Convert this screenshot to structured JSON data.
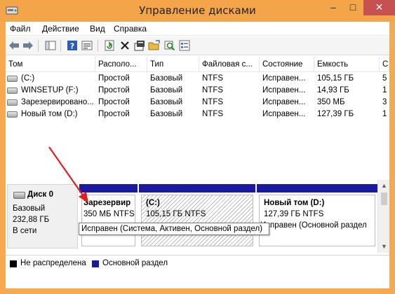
{
  "window": {
    "title": "Управление дисками",
    "controls": {
      "minimize": "–",
      "maximize": "□",
      "close": "✕"
    }
  },
  "menu": [
    "Файл",
    "Действие",
    "Вид",
    "Справка"
  ],
  "toolbar": {
    "icons": [
      "back-arrow-icon",
      "forward-arrow-icon",
      "console-tree-icon",
      "help-icon",
      "properties-icon",
      "refresh-icon",
      "delete-icon",
      "mmc-properties-icon",
      "open-folder-icon",
      "search-disk-icon",
      "view-list-icon"
    ]
  },
  "volumes": {
    "columns": [
      "Том",
      "Располо...",
      "Тип",
      "Файловая с...",
      "Состояние",
      "Емкость",
      "С"
    ],
    "rows": [
      {
        "volume": "(C:)",
        "layout": "Простой",
        "type": "Базовый",
        "fs": "NTFS",
        "status": "Исправен...",
        "capacity": "105,15 ГБ",
        "free": "5"
      },
      {
        "volume": "WINSETUP (F:)",
        "layout": "Простой",
        "type": "Базовый",
        "fs": "NTFS",
        "status": "Исправен...",
        "capacity": "14,93 ГБ",
        "free": "1"
      },
      {
        "volume": "Зарезервировано...",
        "layout": "Простой",
        "type": "Базовый",
        "fs": "NTFS",
        "status": "Исправен...",
        "capacity": "350 МБ",
        "free": "3"
      },
      {
        "volume": "Новый том (D:)",
        "layout": "Простой",
        "type": "Базовый",
        "fs": "NTFS",
        "status": "Исправен...",
        "capacity": "127,39 ГБ",
        "free": "1"
      }
    ]
  },
  "disk": {
    "name": "Диск 0",
    "type": "Базовый",
    "size": "232,88 ГБ",
    "status": "В сети"
  },
  "partitions": [
    {
      "title": "Зарезервир",
      "size": "350 МБ NTFS"
    },
    {
      "title": "(C:)",
      "size": "105,15 ГБ NTFS"
    },
    {
      "title": "Новый том  (D:)",
      "size": "127,39 ГБ NTFS",
      "status": "Исправен (Основной раздел"
    }
  ],
  "tooltip": "Исправен (Система, Активен, Основной раздел)",
  "legend": [
    {
      "label": "Не распределена",
      "color": "#000000"
    },
    {
      "label": "Основной раздел",
      "color": "#1a1aa0"
    }
  ],
  "colors": {
    "titlebar": "#f4a54a",
    "partition_bar": "#1a1aa0",
    "annotation_arrow": "#e02020"
  }
}
